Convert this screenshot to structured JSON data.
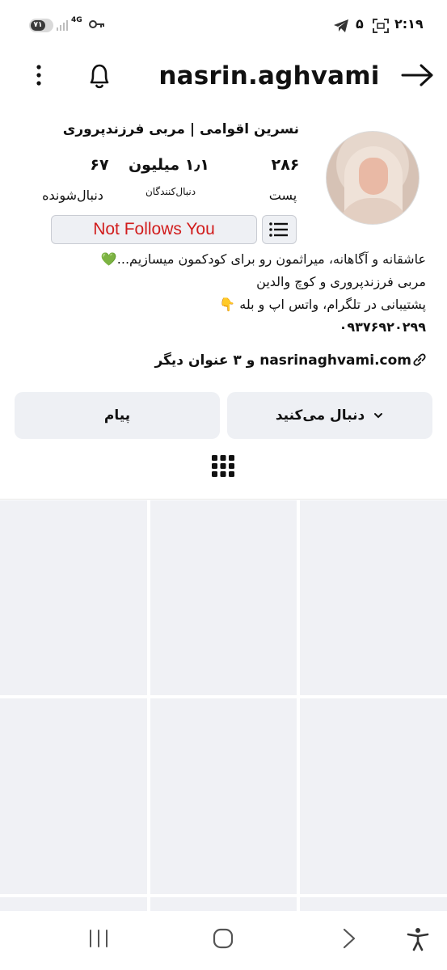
{
  "status_bar": {
    "battery": "٧١",
    "battery_level": 0.71,
    "network": "4G",
    "time": "۲:۱۹",
    "notif_count": "۵",
    "icons": [
      "telegram-icon",
      "screenshot-icon",
      "key-icon",
      "signal-icon"
    ]
  },
  "header": {
    "username": "nasrin.aghvami",
    "icons": [
      "more-options-icon",
      "bell-icon",
      "back-arrow-icon"
    ]
  },
  "profile": {
    "full_name": "نسرین اقوامی | مربی فرزندپروری",
    "stats": {
      "posts_count": "۲۸۶",
      "posts_label": "پست",
      "followers_count": "۱٫۱ میلیون",
      "followers_label": "دنبال‌کنندگان",
      "following_count": "۶۷",
      "following_label": "دنبال‌شونده"
    },
    "not_follows_label": "Not Follows You",
    "bio_lines": [
      "عاشقانه و آگاهانه، میراثمون رو برای کودکمون میسازیم...💚",
      "مربی فرزندپروری و کوچ والدین",
      "پشتیبانی در تلگرام، واتس اپ و بله 👇",
      "۰۹۳۷۶۹۲۰۲۹۹"
    ],
    "link_url": "nasrinaghvami.com",
    "link_more": "و ۳ عنوان دیگر"
  },
  "actions": {
    "following_label": "دنبال می‌کنید",
    "message_label": "پیام"
  },
  "colors": {
    "accent_red": "#d11d1d",
    "button_bg": "#eef0f4",
    "tile_bg": "#f0f1f5",
    "heart": "#22c55e"
  },
  "nav_bar": {
    "icons": [
      "recent-apps-icon",
      "home-icon",
      "back-icon",
      "accessibility-icon"
    ]
  }
}
